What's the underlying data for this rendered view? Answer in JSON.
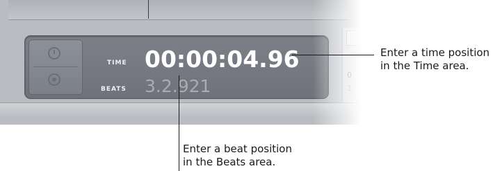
{
  "lcd": {
    "time_label": "TIME",
    "time_value": "00:00:04.96",
    "beats_label": "BEATS",
    "beats_value": "3.2.921"
  },
  "right_strip": {
    "row1": "0",
    "row2": "1"
  },
  "callouts": {
    "time": [
      "Enter a time position",
      "in the Time area."
    ],
    "beats": [
      "Enter a beat position",
      "in the Beats area."
    ]
  },
  "icons": {
    "clock": "clock-icon",
    "note": "beat-note-icon"
  },
  "colors": {
    "lcd_bg": "#74777f",
    "time_text": "#ffffff",
    "beats_text": "#a9acb2"
  }
}
